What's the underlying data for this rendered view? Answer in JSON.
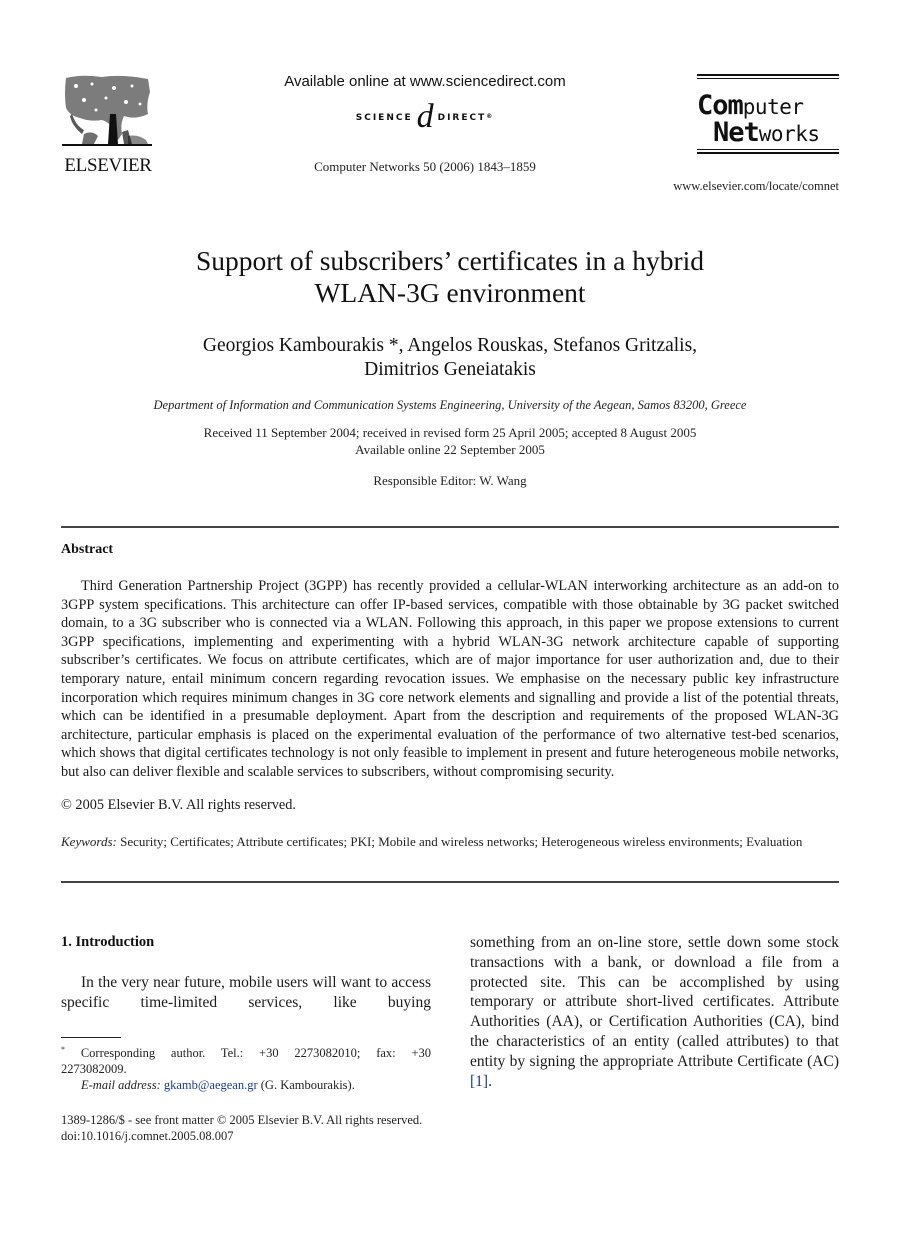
{
  "header": {
    "publisher_logo_text": "ELSEVIER",
    "available_online": "Available online at www.sciencedirect.com",
    "sciencedirect_left": "SCIENCE",
    "sciencedirect_at": "d",
    "sciencedirect_right": "DIRECT",
    "sciencedirect_tm": "®",
    "journal_citation": "Computer Networks 50 (2006) 1843–1859",
    "journal_logo_line1_big": "Com",
    "journal_logo_line1_small": "puter",
    "journal_logo_line2_big": "Net",
    "journal_logo_line2_small": "works",
    "journal_url": "www.elsevier.com/locate/comnet"
  },
  "article": {
    "title_line1": "Support of subscribers’ certificates in a hybrid",
    "title_line2": "WLAN-3G environment",
    "authors_line1": "Georgios Kambourakis *, Angelos Rouskas, Stefanos Gritzalis,",
    "authors_line2": "Dimitrios Geneiatakis",
    "affiliation": "Department of Information and Communication Systems Engineering, University of the Aegean, Samos 83200, Greece",
    "dates_line1": "Received 11 September 2004; received in revised form 25 April 2005; accepted 8 August 2005",
    "dates_line2": "Available online 22 September 2005",
    "responsible_editor": "Responsible Editor: W. Wang"
  },
  "abstract": {
    "heading": "Abstract",
    "body": "Third Generation Partnership Project (3GPP) has recently provided a cellular-WLAN interworking architecture as an add-on to 3GPP system specifications. This architecture can offer IP-based services, compatible with those obtainable by 3G packet switched domain, to a 3G subscriber who is connected via a WLAN. Following this approach, in this paper we propose extensions to current 3GPP specifications, implementing and experimenting with a hybrid WLAN-3G network architecture capable of supporting subscriber’s certificates. We focus on attribute certificates, which are of major importance for user authorization and, due to their temporary nature, entail minimum concern regarding revocation issues. We emphasise on the necessary public key infrastructure incorporation which requires minimum changes in 3G core network elements and signalling and provide a list of the potential threats, which can be identified in a presumable deployment. Apart from the description and requirements of the proposed WLAN-3G architecture, particular emphasis is placed on the experimental evaluation of the performance of two alternative test-bed scenarios, which shows that digital certificates technology is not only feasible to implement in present and future heterogeneous mobile networks, but also can deliver flexible and scalable services to subscribers, without compromising security.",
    "copyright": "© 2005 Elsevier B.V. All rights reserved."
  },
  "keywords": {
    "label": "Keywords:",
    "text": "Security; Certificates; Attribute certificates; PKI; Mobile and wireless networks; Heterogeneous wireless environments; Evaluation"
  },
  "introduction": {
    "heading": "1. Introduction",
    "left_text": "In the very near future, mobile users will want to access specific time-limited services, like buying",
    "right_text": "something from an on-line store, settle down some stock transactions with a bank, or download a file from a protected site. This can be accomplished by using temporary or attribute short-lived certificates. Attribute Authorities (AA), or Certification Authorities (CA), bind the characteristics of an entity (called attributes) to that entity by signing the appropriate Attribute Certificate (AC)",
    "right_ref": "[1]",
    "right_end": "."
  },
  "footnote": {
    "marker": "*",
    "line1": "Corresponding author. Tel.: +30 2273082010; fax: +30",
    "line2": "2273082009.",
    "email_label": "E-mail address:",
    "email": "gkamb@aegean.gr",
    "email_owner": "(G. Kambourakis)."
  },
  "front_matter": {
    "issn_line": "1389-1286/$ - see front matter © 2005 Elsevier B.V. All rights reserved.",
    "doi": "doi:10.1016/j.comnet.2005.08.007"
  },
  "colors": {
    "link": "#1a3a9a",
    "text": "#1a1a1a"
  }
}
